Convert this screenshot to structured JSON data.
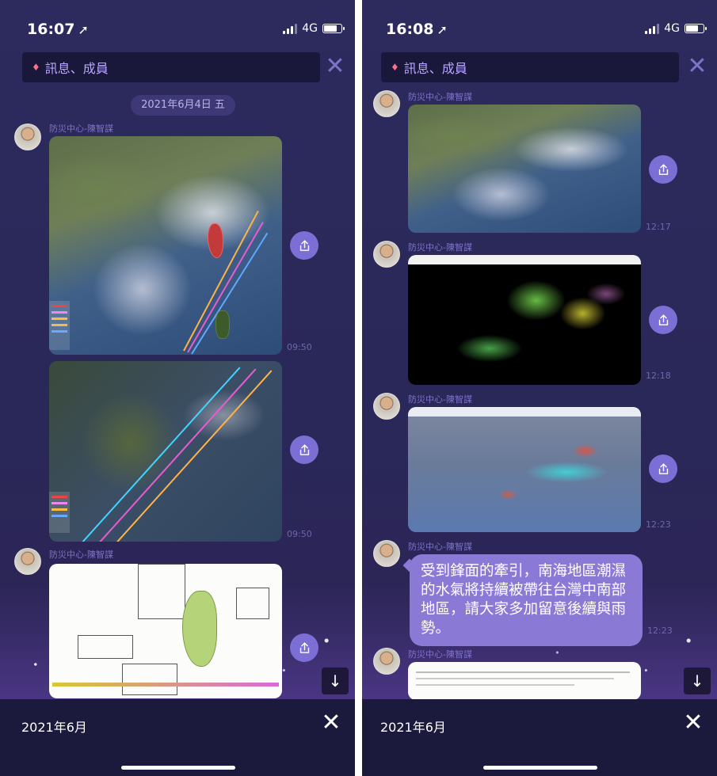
{
  "colors": {
    "accent": "#8a7ad6",
    "background": "#2d2a5e",
    "share_button": "#7b6fd6",
    "sender_name": "#7e72c9"
  },
  "left": {
    "status": {
      "time": "16:07",
      "network": "4G"
    },
    "filter": {
      "label": "訊息、成員",
      "icon": "gem-icon"
    },
    "date_separator": "2021年6月4日 五",
    "messages": [
      {
        "sender": "防災中心-陳智謀",
        "time": "09:50"
      },
      {
        "time": "09:50"
      },
      {
        "sender": "防災中心-陳智謀"
      }
    ],
    "bottom": {
      "month": "2021年6月"
    }
  },
  "right": {
    "status": {
      "time": "16:08",
      "network": "4G"
    },
    "filter": {
      "label": "訊息、成員",
      "icon": "gem-icon"
    },
    "messages": [
      {
        "sender": "防災中心-陳智謀",
        "time": "12:17"
      },
      {
        "sender": "防災中心-陳智謀",
        "time": "12:18"
      },
      {
        "sender": "防災中心-陳智謀",
        "time": "12:23"
      },
      {
        "sender": "防災中心-陳智謀",
        "text": "受到鋒面的牽引，南海地區潮濕的水氣將持續被帶往台灣中南部地區，請大家多加留意後續與雨勢。",
        "time": "12:23"
      },
      {
        "sender": "防災中心-陳智謀"
      }
    ],
    "bottom": {
      "month": "2021年6月"
    }
  }
}
